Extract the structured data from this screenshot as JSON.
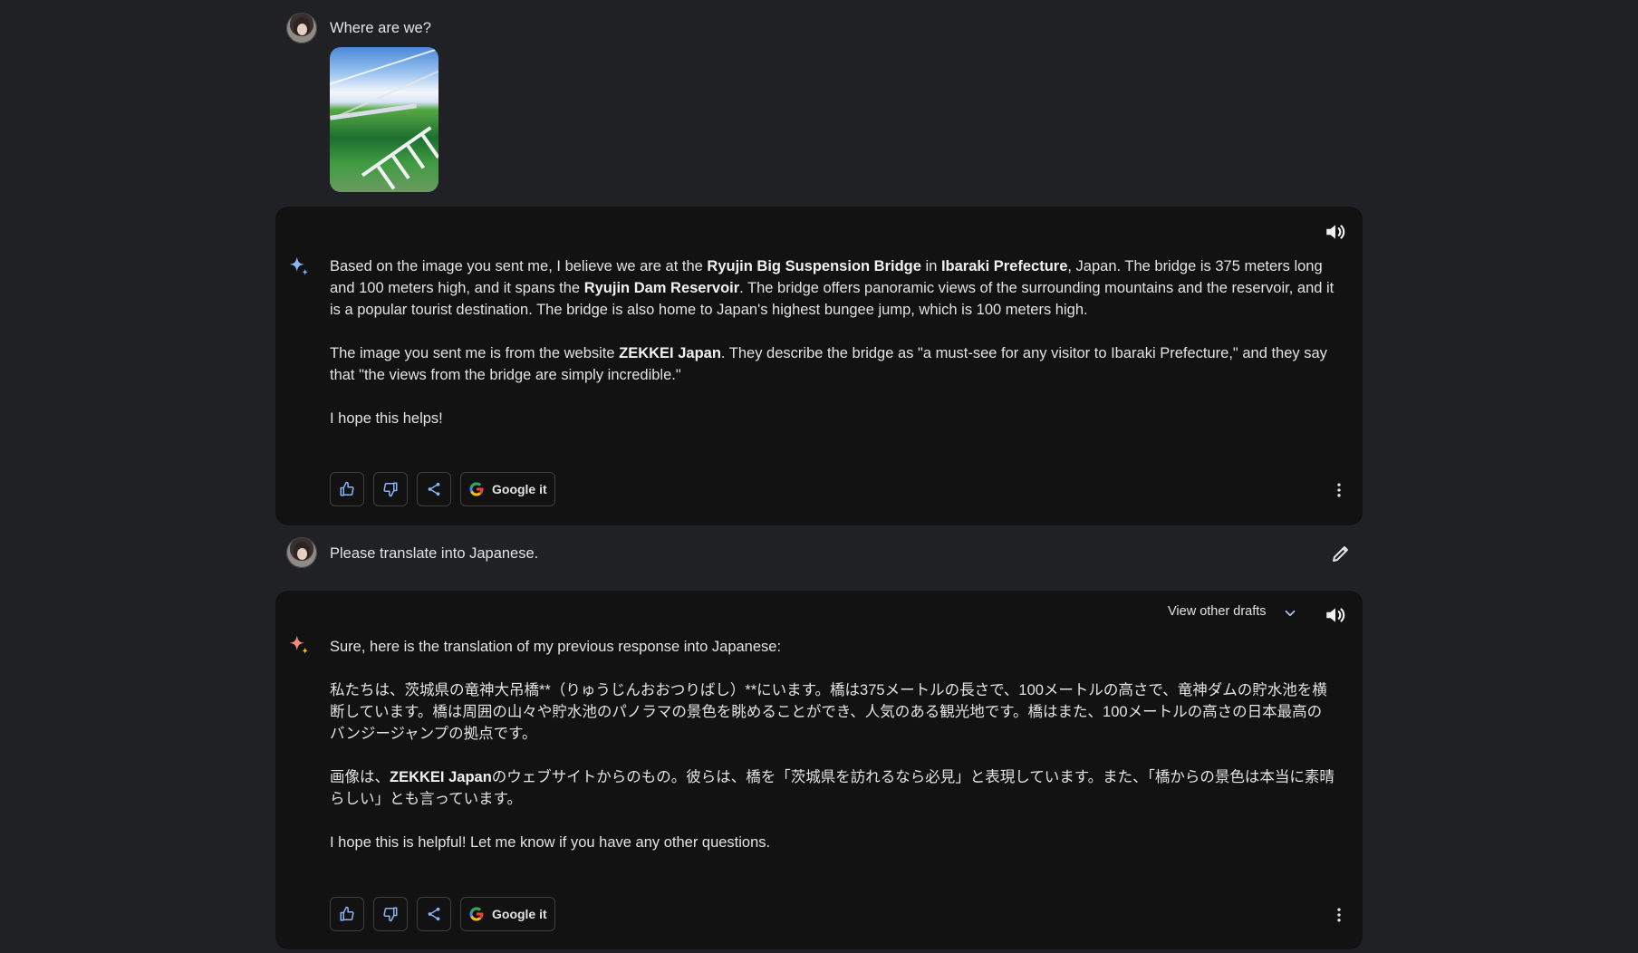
{
  "conversation": {
    "prompt1": {
      "text": "Where are we?",
      "image_alt": "bridge photo"
    },
    "response1": {
      "paragraphs": [
        [
          {
            "text": "Based on the image you sent me, I believe we are at the ",
            "bold": false
          },
          {
            "text": "Ryujin Big Suspension Bridge",
            "bold": true
          },
          {
            "text": " in ",
            "bold": false
          },
          {
            "text": "Ibaraki Prefecture",
            "bold": true
          },
          {
            "text": ", Japan. The bridge is 375 meters long and 100 meters high, and it spans the ",
            "bold": false
          },
          {
            "text": "Ryujin Dam Reservoir",
            "bold": true
          },
          {
            "text": ". The bridge offers panoramic views of the surrounding mountains and the reservoir, and it is a popular tourist destination. The bridge is also home to Japan's highest bungee jump, which is 100 meters high.",
            "bold": false
          }
        ],
        [
          {
            "text": "The image you sent me is from the website ",
            "bold": false
          },
          {
            "text": "ZEKKEI Japan",
            "bold": true
          },
          {
            "text": ". They describe the bridge as \"a must-see for any visitor to Ibaraki Prefecture,\" and they say that \"the views from the bridge are simply incredible.\"",
            "bold": false
          }
        ],
        [
          {
            "text": "I hope this helps!",
            "bold": false
          }
        ]
      ],
      "actions": {
        "google_label": "Google it"
      }
    },
    "prompt2": {
      "text": "Please translate into Japanese."
    },
    "response2": {
      "header": {
        "drafts_label": "View other drafts"
      },
      "paragraphs": [
        [
          {
            "text": "Sure, here is the translation of my previous response into Japanese:",
            "bold": false
          }
        ],
        [
          {
            "text": "私たちは、茨城県の竜神大吊橋**（りゅうじんおおつりばし）**にいます。橋は375メートルの長さで、100メートルの高さで、竜神ダムの貯水池を横断しています。橋は周囲の山々や貯水池のパノラマの景色を眺めることができ、人気のある観光地です。橋はまた、100メートルの高さの日本最高のバンジージャンプの拠点です。",
            "bold": false
          }
        ],
        [
          {
            "text": "画像は、",
            "bold": false
          },
          {
            "text": "ZEKKEI Japan",
            "bold": true
          },
          {
            "text": "のウェブサイトからのもの。彼らは、橋を「茨城県を訪れるなら必見」と表現しています。また、「橋からの景色は本当に素晴らしい」とも言っています。",
            "bold": false
          }
        ],
        [
          {
            "text": "I hope this is helpful! Let me know if you have any other questions.",
            "bold": false
          }
        ]
      ],
      "actions": {
        "google_label": "Google it"
      }
    }
  },
  "icons": {
    "user_avatar": "avatar",
    "assistant_logo": "sparkle-icon",
    "speaker": "speaker-icon",
    "like": "thumbs-up-icon",
    "dislike": "thumbs-down-icon",
    "share": "share-icon",
    "more": "more-vert-icon",
    "edit": "pencil-icon",
    "chevron": "chevron-down-icon",
    "google": "google-icon"
  },
  "colors": {
    "page_background": "#202124",
    "card_background": "#121212",
    "text": "#e3e3e3",
    "accent": "#8ab4f8"
  }
}
